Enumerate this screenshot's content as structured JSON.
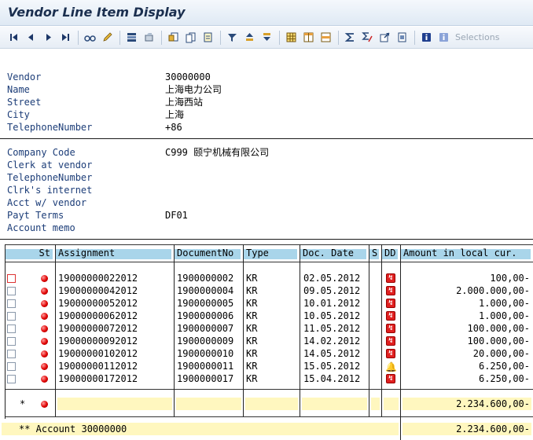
{
  "window": {
    "title": "Vendor Line Item Display"
  },
  "toolbar": {
    "icons": [
      "first-page-icon",
      "previous-page-icon",
      "next-page-icon",
      "last-page-icon",
      "glasses-icon",
      "pencil-icon",
      "select-layout-icon",
      "clear-icon",
      "document-icon",
      "document-copy-icon",
      "document-info-icon",
      "filter-icon",
      "sort-ascending-icon",
      "sort-descending-icon",
      "grid-icon",
      "columns-icon",
      "rows-icon",
      "sum-icon",
      "subtotal-icon",
      "export-icon",
      "print-icon",
      "info-icon",
      "info-selections-icon"
    ],
    "selections_label": "Selections"
  },
  "vendor": {
    "fields": [
      {
        "label": "Vendor",
        "value": "30000000"
      },
      {
        "label": "Name",
        "value": "上海电力公司"
      },
      {
        "label": "Street",
        "value": "上海西站"
      },
      {
        "label": "City",
        "value": "上海"
      },
      {
        "label": "TelephoneNumber",
        "value": "+86"
      }
    ]
  },
  "company": {
    "fields": [
      {
        "label": "Company Code",
        "value": "C999 颐宁机械有限公司"
      },
      {
        "label": "Clerk at vendor",
        "value": ""
      },
      {
        "label": "TelephoneNumber",
        "value": ""
      },
      {
        "label": "Clrk's internet",
        "value": ""
      },
      {
        "label": "Acct w/ vendor",
        "value": ""
      },
      {
        "label": "Payt Terms",
        "value": "DF01"
      },
      {
        "label": "Account memo",
        "value": ""
      }
    ]
  },
  "table": {
    "headers": {
      "st": "St",
      "assignment": "Assignment",
      "document_no": "DocumentNo",
      "type": "Type",
      "doc_date": "Doc. Date",
      "s": "S",
      "dd": "DD",
      "amount": "Amount in local cur."
    },
    "rows": [
      {
        "assignment": "19000000022012",
        "document_no": "1900000002",
        "type": "KR",
        "doc_date": "02.05.2012",
        "dd": "red",
        "amount": "100,00-"
      },
      {
        "assignment": "19000000042012",
        "document_no": "1900000004",
        "type": "KR",
        "doc_date": "09.05.2012",
        "dd": "red",
        "amount": "2.000.000,00-"
      },
      {
        "assignment": "19000000052012",
        "document_no": "1900000005",
        "type": "KR",
        "doc_date": "10.01.2012",
        "dd": "red",
        "amount": "1.000,00-"
      },
      {
        "assignment": "19000000062012",
        "document_no": "1900000006",
        "type": "KR",
        "doc_date": "10.05.2012",
        "dd": "red",
        "amount": "1.000,00-"
      },
      {
        "assignment": "19000000072012",
        "document_no": "1900000007",
        "type": "KR",
        "doc_date": "11.05.2012",
        "dd": "red",
        "amount": "100.000,00-"
      },
      {
        "assignment": "19000000092012",
        "document_no": "1900000009",
        "type": "KR",
        "doc_date": "14.02.2012",
        "dd": "red",
        "amount": "100.000,00-"
      },
      {
        "assignment": "19000000102012",
        "document_no": "1900000010",
        "type": "KR",
        "doc_date": "14.05.2012",
        "dd": "red",
        "amount": "20.000,00-"
      },
      {
        "assignment": "19000000112012",
        "document_no": "1900000011",
        "type": "KR",
        "doc_date": "15.05.2012",
        "dd": "bell",
        "amount": "6.250,00-"
      },
      {
        "assignment": "19000000172012",
        "document_no": "1900000017",
        "type": "KR",
        "doc_date": "15.04.2012",
        "dd": "red",
        "amount": "6.250,00-"
      }
    ],
    "subtotal": {
      "marker": "*",
      "amount": "2.234.600,00-"
    },
    "total": {
      "label": "** Account 30000000",
      "amount": "2.234.600,00-"
    }
  }
}
